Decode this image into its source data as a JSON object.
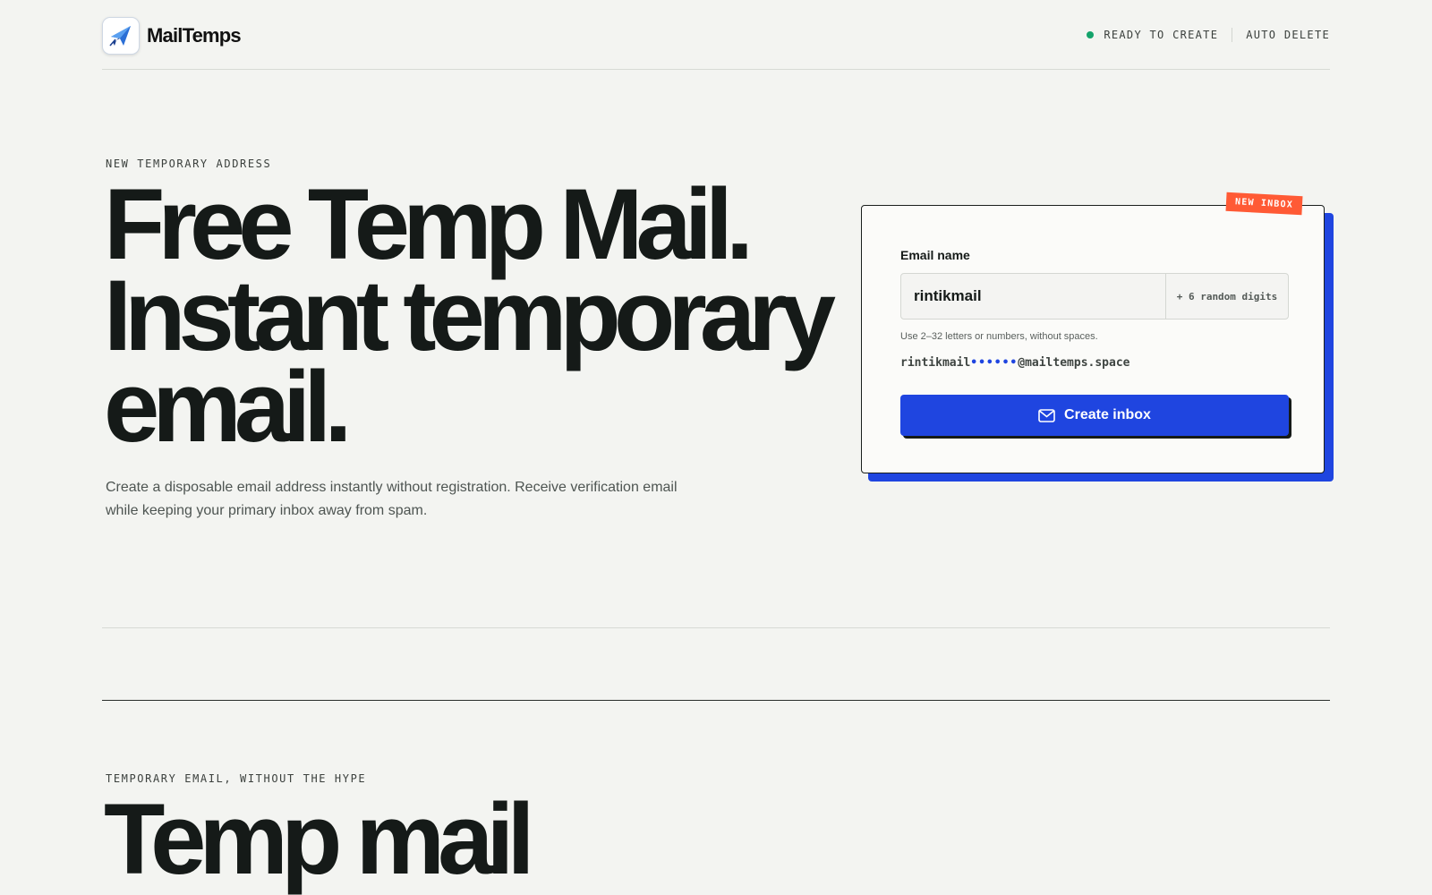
{
  "header": {
    "brand": "MailTemps",
    "status_label": "READY TO CREATE",
    "auto_delete_label": "AUTO DELETE",
    "status_color": "#14a36b"
  },
  "hero": {
    "eyebrow": "NEW TEMPORARY ADDRESS",
    "title_line1": "Free Temp Mail.",
    "title_line2": "Instant temporary",
    "title_line3": "email.",
    "description": "Create a disposable email address instantly without registration. Receive verification email while keeping your primary inbox away from spam."
  },
  "card": {
    "badge": "NEW INBOX",
    "field_label": "Email name",
    "input_value": "rintikmail",
    "suffix": "+ 6 random digits",
    "hint": "Use 2–32 letters or numbers, without spaces.",
    "preview_name": "rintikmail",
    "preview_dots": "••••••",
    "preview_domain": "@mailtemps.space",
    "button_label": "Create inbox",
    "button_icon": "mail-icon",
    "accent_color": "#1f45e0",
    "badge_color": "#ff5a35"
  },
  "section": {
    "eyebrow": "TEMPORARY EMAIL, WITHOUT THE HYPE",
    "title_peek": "Temp mail"
  }
}
